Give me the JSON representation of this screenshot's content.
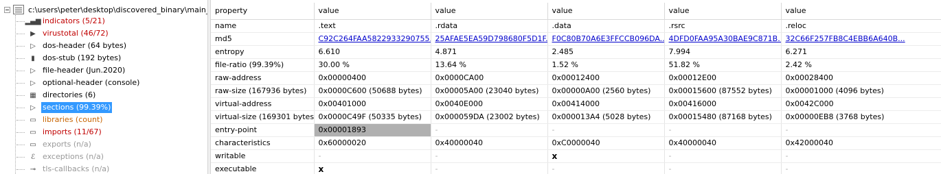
{
  "tree": {
    "root_label": "c:\\users\\peter\\desktop\\discovered_binary\\main_",
    "items": [
      {
        "label": "indicators (5/21)",
        "color": "red",
        "icon": "bars-icon",
        "glyph": "▂▄▆"
      },
      {
        "label": "virustotal (46/72)",
        "color": "red",
        "icon": "virustotal-icon",
        "glyph": "▶"
      },
      {
        "label": "dos-header (64 bytes)",
        "color": "black",
        "icon": "chevron-right-icon",
        "glyph": "▷"
      },
      {
        "label": "dos-stub (192 bytes)",
        "color": "black",
        "icon": "console-icon",
        "glyph": "▮"
      },
      {
        "label": "file-header (Jun.2020)",
        "color": "black",
        "icon": "chevron-right-icon",
        "glyph": "▷"
      },
      {
        "label": "optional-header (console)",
        "color": "black",
        "icon": "chevron-right-icon",
        "glyph": "▷"
      },
      {
        "label": "directories (6)",
        "color": "black",
        "icon": "grid-icon",
        "glyph": "▦"
      },
      {
        "label": "sections (99.39%)",
        "color": "black",
        "icon": "chevron-right-icon",
        "glyph": "▷",
        "selected": true
      },
      {
        "label": "libraries (count)",
        "color": "orange",
        "icon": "library-icon",
        "glyph": "▭"
      },
      {
        "label": "imports (11/67)",
        "color": "red",
        "icon": "imports-icon",
        "glyph": "▭"
      },
      {
        "label": "exports (n/a)",
        "color": "gray",
        "icon": "exports-icon",
        "glyph": "▭"
      },
      {
        "label": "exceptions (n/a)",
        "color": "gray",
        "icon": "exceptions-icon",
        "glyph": "ℰ"
      },
      {
        "label": "tls-callbacks (n/a)",
        "color": "gray",
        "icon": "key-icon",
        "glyph": "⊸"
      }
    ]
  },
  "grid": {
    "headers": [
      "property",
      "value",
      "value",
      "value",
      "value",
      "value"
    ],
    "rows": [
      [
        "name",
        ".text",
        ".rdata",
        ".data",
        ".rsrc",
        ".reloc"
      ],
      [
        "md5",
        "C92C264FAA5822933290755...",
        "25AFAE5EA59D798680F5D1F...",
        "F0C80B70A6E3FFCCB096DA...",
        "4DFD0FAA95A30BAE9C871B...",
        "32C66F257FB8C4EBB6A640B..."
      ],
      [
        "entropy",
        "6.610",
        "4.871",
        "2.485",
        "7.994",
        "6.271"
      ],
      [
        "file-ratio (99.39%)",
        "30.00 %",
        "13.64 %",
        "1.52 %",
        "51.82 %",
        "2.42 %"
      ],
      [
        "raw-address",
        "0x00000400",
        "0x0000CA00",
        "0x00012400",
        "0x00012E00",
        "0x00028400"
      ],
      [
        "raw-size (167936 bytes)",
        "0x0000C600 (50688 bytes)",
        "0x00005A00 (23040 bytes)",
        "0x00000A00 (2560 bytes)",
        "0x00015600 (87552 bytes)",
        "0x00001000 (4096 bytes)"
      ],
      [
        "virtual-address",
        "0x00401000",
        "0x0040E000",
        "0x00414000",
        "0x00416000",
        "0x0042C000"
      ],
      [
        "virtual-size (169301 bytes)",
        "0x0000C49F (50335 bytes)",
        "0x000059DA (23002 bytes)",
        "0x000013A4 (5028 bytes)",
        "0x00015480 (87168 bytes)",
        "0x00000EB8 (3768 bytes)"
      ],
      [
        "entry-point",
        "0x00001893",
        "-",
        "-",
        "-",
        "-"
      ],
      [
        "characteristics",
        "0x60000020",
        "0x40000040",
        "0xC0000040",
        "0x40000040",
        "0x42000040"
      ],
      [
        "writable",
        "-",
        "-",
        "x",
        "-",
        "-"
      ],
      [
        "executable",
        "x",
        "-",
        "-",
        "-",
        "-"
      ]
    ]
  },
  "colors": {
    "selection": "#3399ff",
    "link": "#0000cc",
    "red": "#c00000",
    "orange": "#c86400",
    "highlight": "#b0b0b0"
  }
}
